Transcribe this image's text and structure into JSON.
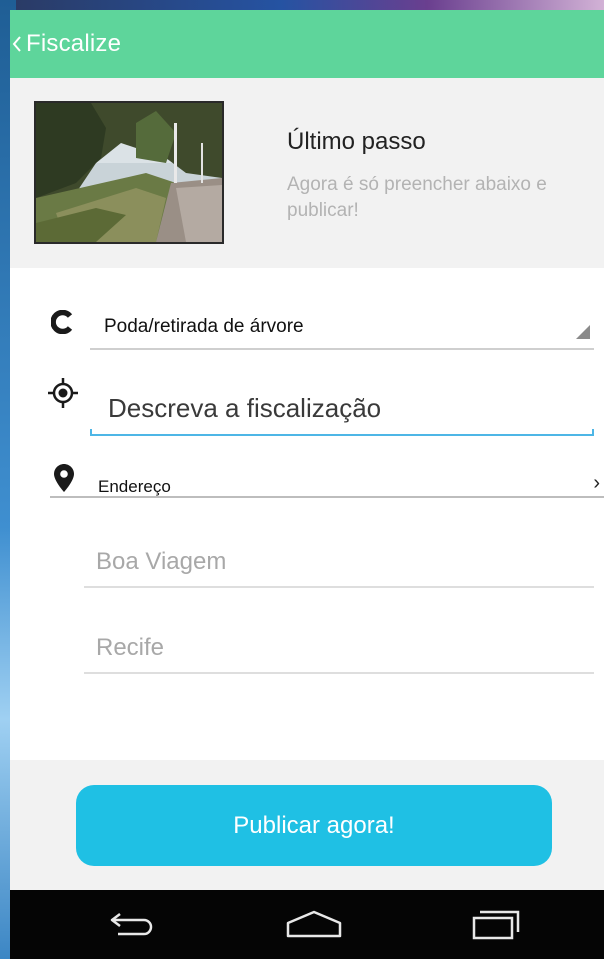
{
  "app": {
    "title": "Fiscalize"
  },
  "header": {
    "title": "Último passo",
    "subtitle": "Agora é só preencher abaixo e publicar!"
  },
  "form": {
    "category": {
      "selected": "Poda/retirada de árvore"
    },
    "description": {
      "placeholder": "Descreva a fiscalização"
    },
    "address": {
      "label": "Endereço",
      "chevron": "›"
    },
    "neighborhood": {
      "value": "Boa Viagem"
    },
    "city": {
      "value": "Recife"
    }
  },
  "actions": {
    "publish_label": "Publicar agora!"
  },
  "colors": {
    "appbar": "#5ed59b",
    "accent": "#4db6e6",
    "publish_button": "#1fc0e4",
    "navbar": "#050505"
  },
  "icons": {
    "back": "chevron-left-icon",
    "category": "c-logo-icon",
    "description": "crosshair-target-icon",
    "address": "map-pin-icon",
    "nav": [
      "back-arrow-icon",
      "home-icon",
      "recents-icon"
    ]
  }
}
